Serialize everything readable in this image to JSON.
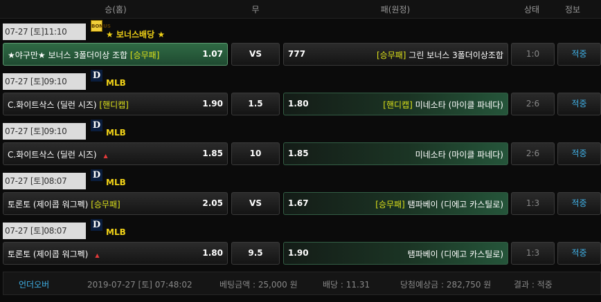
{
  "header": {
    "home": "승(홈)",
    "draw": "무",
    "away": "패(원정)",
    "status": "상태",
    "info": "정보"
  },
  "groups": [
    {
      "date": "07-27 [토]11:10",
      "league_icon": "bonus-badge-icon",
      "league": "★ 보너스배당 ★",
      "home": {
        "name": "★야구만★ 보너스 3폴더이상 조합",
        "tag": "[승무패]",
        "odds": "1.07",
        "selected": true
      },
      "draw": "VS",
      "away": {
        "name": "그린 보너스 3폴더이상조합",
        "tag": "[승무패]",
        "odds": "777",
        "selected": false
      },
      "status": "1:0",
      "info": "적중"
    },
    {
      "date": "07-27 [토]09:10",
      "league_icon": "mlb-logo-icon",
      "league": "MLB",
      "home": {
        "name": "C.화이트삭스 (딜런 시즈)",
        "tag": "[핸디캡]",
        "odds": "1.90",
        "selected": false
      },
      "draw": "1.5",
      "away": {
        "name": "미네소타 (마이클 파네다)",
        "tag": "[핸디캡]",
        "odds": "1.80",
        "selected": true
      },
      "status": "2:6",
      "info": "적중"
    },
    {
      "date": "07-27 [토]09:10",
      "league_icon": "mlb-logo-icon",
      "league": "MLB",
      "home": {
        "name": "C.화이트삭스 (딜런 시즈)",
        "tag": "",
        "odds": "1.85",
        "selected": false
      },
      "draw": "10",
      "away": {
        "name": "미네소타 (마이클 파네다)",
        "tag": "",
        "odds": "1.85",
        "selected": true
      },
      "status": "2:6",
      "info": "적중"
    },
    {
      "date": "07-27 [토]08:07",
      "league_icon": "mlb-logo-icon",
      "league": "MLB",
      "home": {
        "name": "토론토 (제이콥 워그펙)",
        "tag": "[승무패]",
        "odds": "2.05",
        "selected": false
      },
      "draw": "VS",
      "away": {
        "name": "탬파베이 (디에고 카스틸로)",
        "tag": "[승무패]",
        "odds": "1.67",
        "selected": true
      },
      "status": "1:3",
      "info": "적중"
    },
    {
      "date": "07-27 [토]08:07",
      "league_icon": "mlb-logo-icon",
      "league": "MLB",
      "home": {
        "name": "토론토 (제이콥 워그펙)",
        "tag": "",
        "odds": "1.80",
        "selected": false
      },
      "draw": "9.5",
      "away": {
        "name": "탬파베이 (디에고 카스틸로)",
        "tag": "",
        "odds": "1.90",
        "selected": true
      },
      "status": "1:3",
      "info": "적중"
    }
  ],
  "summary": {
    "type": "언더오버",
    "datetime": "2019-07-27 [토] 07:48:02",
    "bet_amount": "베팅금액 : 25,000 원",
    "rate": "배당 : 11.31",
    "expected": "당첨예상금 : 282,750 원",
    "result": "결과 : 적중"
  },
  "colors": {
    "accent_green": "#2f6a44",
    "tag_yellow": "#dde21a",
    "league_yellow": "#f1d217",
    "info_blue": "#3fb0e6"
  }
}
